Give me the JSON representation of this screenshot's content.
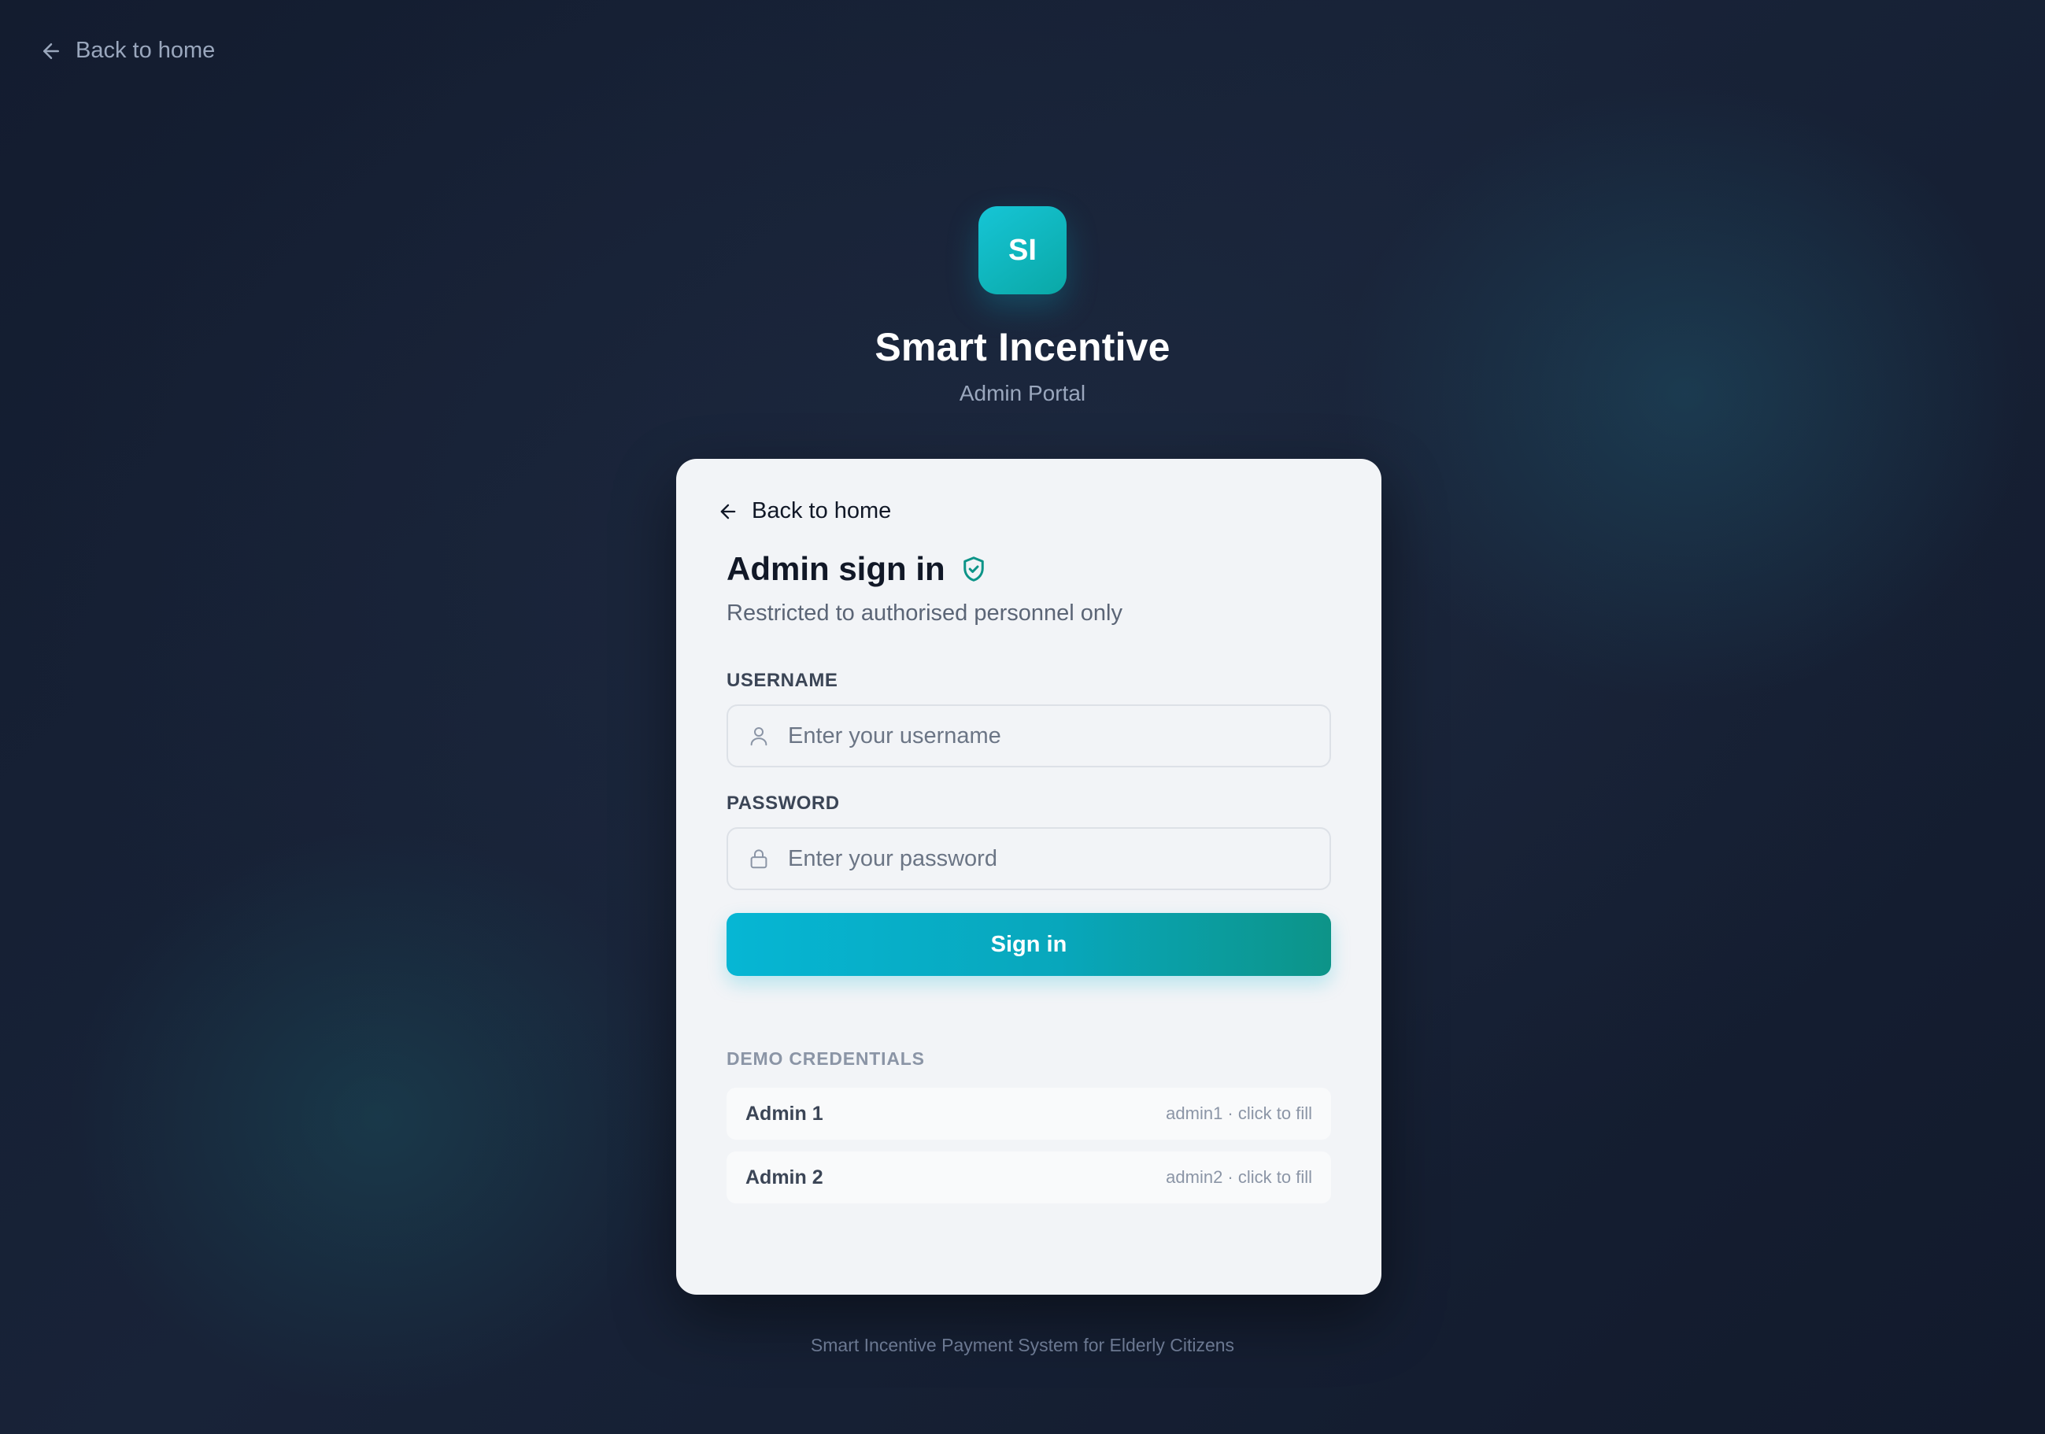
{
  "top_nav": {
    "back_label": "Back to home",
    "icon": "arrow-left-icon"
  },
  "brand": {
    "logo_text": "SI",
    "title": "Smart Incentive",
    "subtitle": "Admin Portal",
    "accent_color": "#06b6d4"
  },
  "card": {
    "back_label": "Back to home",
    "heading": "Admin sign in",
    "heading_icon": "shield-check-icon",
    "subheading": "Restricted to authorised personnel only",
    "username": {
      "label": "USERNAME",
      "placeholder": "Enter your username",
      "value": "",
      "icon": "user-icon"
    },
    "password": {
      "label": "PASSWORD",
      "placeholder": "Enter your password",
      "value": "",
      "icon": "lock-icon"
    },
    "submit_label": "Sign in",
    "demo": {
      "title": "DEMO CREDENTIALS",
      "items": [
        {
          "name": "Admin 1",
          "hint": "admin1 · click to fill"
        },
        {
          "name": "Admin 2",
          "hint": "admin2 · click to fill"
        }
      ]
    }
  },
  "footer": {
    "text": "Smart Incentive Payment System for Elderly Citizens"
  }
}
